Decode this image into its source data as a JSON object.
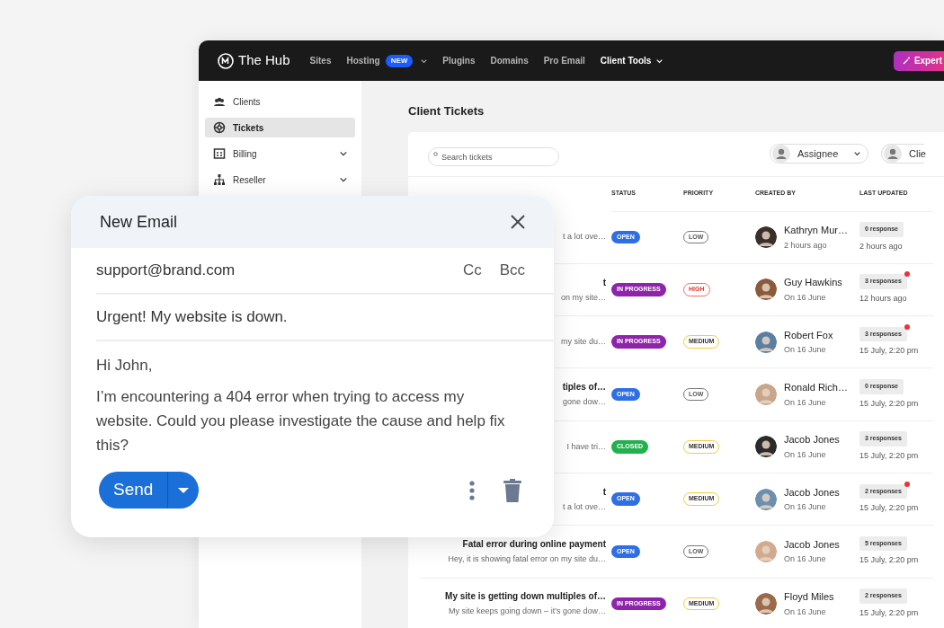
{
  "app": {
    "name": "The Hub",
    "action": "Expert"
  },
  "nav": [
    {
      "label": "Sites",
      "selected": false
    },
    {
      "label": "Hosting",
      "badge": "NEW",
      "dropdown": true,
      "selected": false
    },
    {
      "label": "Plugins",
      "selected": false
    },
    {
      "label": "Domains",
      "selected": false
    },
    {
      "label": "Pro Email",
      "selected": false
    },
    {
      "label": "Client Tools",
      "dropdown": true,
      "selected": true
    }
  ],
  "sidebar": {
    "items": [
      {
        "label": "Clients",
        "kind": "people",
        "selected": false,
        "expandable": false
      },
      {
        "label": "Tickets",
        "kind": "lifebuoy",
        "selected": true,
        "expandable": false
      },
      {
        "label": "Billing",
        "kind": "card",
        "selected": false,
        "expandable": true
      },
      {
        "label": "Reseller",
        "kind": "tree",
        "selected": false,
        "expandable": true
      }
    ]
  },
  "page_title": "Client Tickets",
  "toolbar": {
    "search_placeholder": "Search tickets",
    "filters": [
      "Assignee",
      "Clie"
    ]
  },
  "table": {
    "columns": [
      "STATUS",
      "PRIORITY",
      "CREATED BY",
      "LAST UPDATED"
    ],
    "rows": [
      {
        "ticket_subtitle": "t a lot ove…",
        "status": {
          "text": "OPEN",
          "kind": "open"
        },
        "priority": {
          "text": "LOW",
          "kind": "low"
        },
        "creator": "Kathryn Mur…",
        "created": "2 hours ago",
        "responses": "0 response",
        "unread": false,
        "updated": "2 hours ago"
      },
      {
        "ticket_title": "t",
        "ticket_subtitle": "on my site…",
        "status": {
          "text": "IN PROGRESS",
          "kind": "progress"
        },
        "priority": {
          "text": "HIGH",
          "kind": "high"
        },
        "creator": "Guy Hawkins",
        "created": "On 16 June",
        "responses": "3 responses",
        "unread": true,
        "updated": "12 hours ago"
      },
      {
        "ticket_subtitle": "my site du…",
        "status": {
          "text": "IN PROGRESS",
          "kind": "progress"
        },
        "priority": {
          "text": "MEDIUM",
          "kind": "medium"
        },
        "creator": "Robert Fox",
        "created": "On 16 June",
        "responses": "3 responses",
        "unread": true,
        "updated": "15 July, 2:20 pm"
      },
      {
        "ticket_title": "tiples of…",
        "ticket_subtitle": "gone dow…",
        "status": {
          "text": "OPEN",
          "kind": "open"
        },
        "priority": {
          "text": "LOW",
          "kind": "low"
        },
        "creator": "Ronald Rich…",
        "created": "On 16 June",
        "responses": "0 response",
        "unread": false,
        "updated": "15 July, 2:20 pm"
      },
      {
        "ticket_subtitle": "I  have tri…",
        "status": {
          "text": "CLOSED",
          "kind": "closed"
        },
        "priority": {
          "text": "MEDIUM",
          "kind": "medium"
        },
        "creator": "Jacob Jones",
        "created": "On 16 June",
        "responses": "3 responses",
        "unread": false,
        "updated": "15 July, 2:20 pm"
      },
      {
        "ticket_title": "t",
        "ticket_subtitle": "t a lot ove…",
        "status": {
          "text": "OPEN",
          "kind": "open"
        },
        "priority": {
          "text": "MEDIUM",
          "kind": "medium"
        },
        "creator": "Jacob Jones",
        "created": "On 16 June",
        "responses": "2 responses",
        "unread": true,
        "updated": "15 July, 2:20 pm"
      },
      {
        "ticket_title": "Fatal error during online payment",
        "ticket_subtitle": "Hey, it is showing fatal error on my site du…",
        "status": {
          "text": "OPEN",
          "kind": "open"
        },
        "priority": {
          "text": "LOW",
          "kind": "low"
        },
        "creator": "Jacob Jones",
        "created": "On 16 June",
        "responses": "5 responses",
        "unread": false,
        "updated": "15 July, 2:20 pm"
      },
      {
        "ticket_title": "My site is getting down multiples of…",
        "ticket_subtitle": "My site keeps going down – it’s gone dow…",
        "status": {
          "text": "IN PROGRESS",
          "kind": "progress"
        },
        "priority": {
          "text": "MEDIUM",
          "kind": "medium"
        },
        "creator": "Floyd Miles",
        "created": "On 16 June",
        "responses": "2 responses",
        "unread": false,
        "updated": "15 July, 2:20 pm"
      }
    ]
  },
  "email": {
    "title": "New Email",
    "to": "support@brand.com",
    "cc": "Cc",
    "bcc": "Bcc",
    "subject": "Urgent! My website is down.",
    "greeting": "Hi John,",
    "body": "I’m encountering a 404 error when trying to access my website. Could you please investigate the cause and help fix this?",
    "send": "Send"
  }
}
